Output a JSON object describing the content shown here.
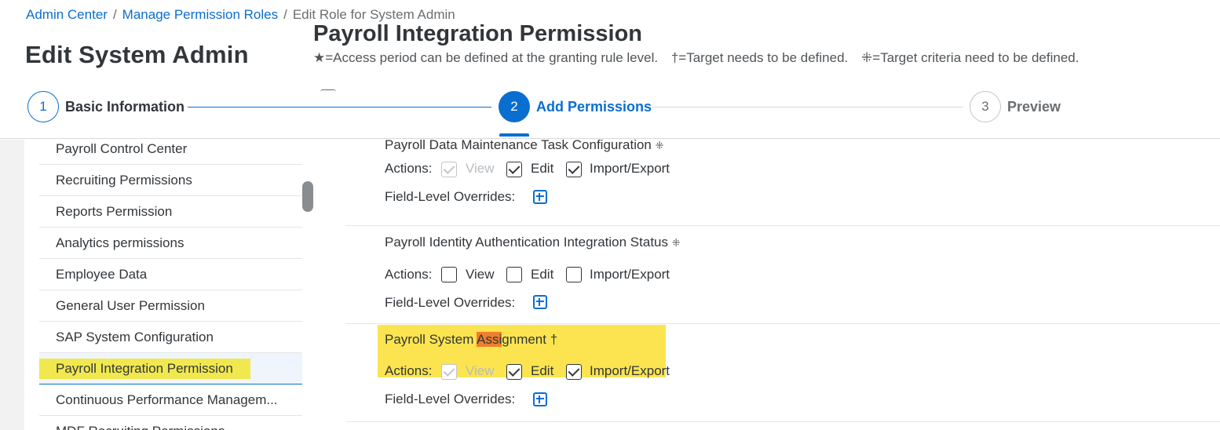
{
  "breadcrumb": {
    "items": [
      "Admin Center",
      "Manage Permission Roles"
    ],
    "current": "Edit Role for System Admin",
    "separator": "/"
  },
  "page_title": "Edit System Admin",
  "permission_header": {
    "title": "Payroll Integration Permission",
    "legend_1": "★=Access period can be defined at the granting rule level.",
    "legend_2": "†=Target needs to be defined.",
    "legend_3": "⁜=Target criteria need to be defined."
  },
  "wizard": {
    "steps": [
      {
        "number": "1",
        "label": "Basic Information"
      },
      {
        "number": "2",
        "label": "Add Permissions"
      },
      {
        "number": "3",
        "label": "Preview"
      }
    ]
  },
  "sidebar": {
    "items": [
      {
        "label": "Payroll Control Center"
      },
      {
        "label": "Recruiting Permissions"
      },
      {
        "label": "Reports Permission"
      },
      {
        "label": "Analytics permissions"
      },
      {
        "label": "Employee Data"
      },
      {
        "label": "General User Permission"
      },
      {
        "label": "SAP System Configuration"
      },
      {
        "label": "Payroll Integration Permission"
      },
      {
        "label": "Continuous Performance Managem..."
      },
      {
        "label": "MDF Recruiting Permissions"
      }
    ],
    "selected": "Payroll Integration Permission"
  },
  "permissions": [
    {
      "name": "Payroll Data Maintenance Task Configuration",
      "mark": "⁜",
      "actions_label": "Actions:",
      "view_label": "View",
      "view_checked": true,
      "view_disabled": true,
      "edit_label": "Edit",
      "edit_checked": true,
      "import_label": "Import/Export",
      "import_checked": true,
      "overrides_label": "Field-Level Overrides:"
    },
    {
      "name": "Payroll Identity Authentication Integration Status",
      "mark": "⁜",
      "actions_label": "Actions:",
      "view_label": "View",
      "view_checked": false,
      "edit_label": "Edit",
      "edit_checked": false,
      "import_label": "Import/Export",
      "import_checked": false,
      "overrides_label": "Field-Level Overrides:"
    },
    {
      "name_prefix": "Payroll System ",
      "name_highlight": "Assi",
      "name_suffix": "gnment",
      "mark": "†",
      "actions_label": "Actions:",
      "view_label": "View",
      "view_checked": true,
      "view_disabled": true,
      "edit_label": "Edit",
      "edit_checked": true,
      "import_label": "Import/Export",
      "import_checked": true,
      "overrides_label": "Field-Level Overrides:"
    }
  ],
  "colors": {
    "accent": "#0a6ed1",
    "highlight": "#fbe44f",
    "search_match": "#f07e2b"
  }
}
